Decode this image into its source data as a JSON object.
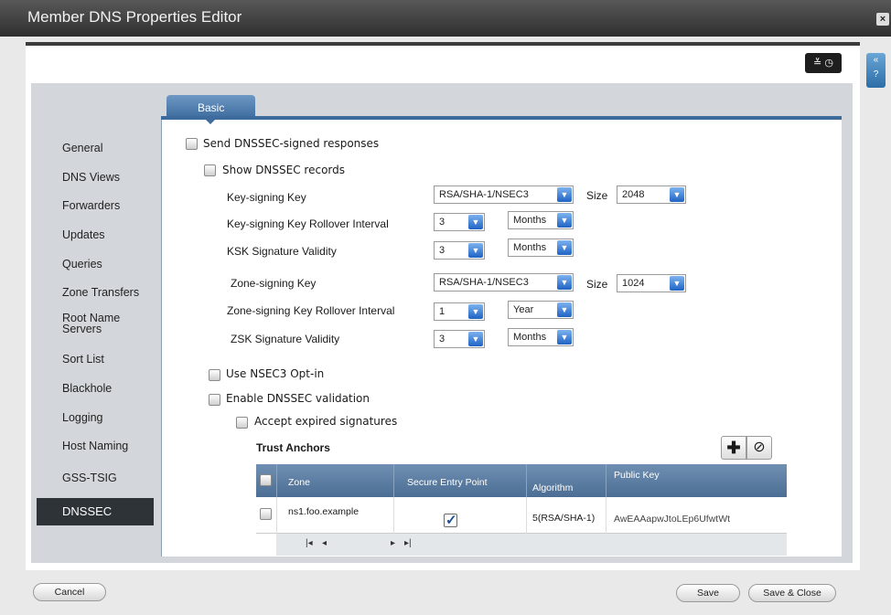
{
  "window": {
    "title": "Member DNS Properties Editor",
    "close_icon": "close-icon"
  },
  "toolbar": {
    "icons": [
      "collapse-icon",
      "history-icon"
    ]
  },
  "nav": {
    "items": [
      "General",
      "DNS Views",
      "Forwarders",
      "Updates",
      "Queries",
      "Zone Transfers",
      "Root Name Servers",
      "Sort List",
      "Blackhole",
      "Logging",
      "Host Naming",
      "GSS-TSIG",
      "DNSSEC"
    ],
    "active": "DNSSEC"
  },
  "tabs": {
    "basic": "Basic"
  },
  "form": {
    "send_dnssec": "Send DNSSEC-signed responses",
    "show_dnssec": "Show DNSSEC records",
    "ksk_label": "Key-signing Key",
    "ksk_algorithm": "RSA/SHA-1/NSEC3",
    "size_label": "Size",
    "ksk_size": "2048",
    "ksk_rollover_label": "Key-signing Key Rollover Interval",
    "ksk_rollover_value": "3",
    "ksk_rollover_unit": "Months",
    "ksk_validity_label": "KSK Signature Validity",
    "ksk_validity_value": "3",
    "ksk_validity_unit": "Months",
    "zsk_label": "Zone-signing Key",
    "zsk_algorithm": "RSA/SHA-1/NSEC3",
    "zsk_size": "1024",
    "zsk_rollover_label": "Zone-signing Key Rollover Interval",
    "zsk_rollover_value": "1",
    "zsk_rollover_unit": "Year",
    "zsk_validity_label": "ZSK Signature Validity",
    "zsk_validity_value": "3",
    "zsk_validity_unit": "Months",
    "nsec3_optin": "Use NSEC3 Opt-in",
    "enable_validation": "Enable  DNSSEC validation",
    "accept_expired": "Accept expired signatures"
  },
  "trust_anchors": {
    "title": "Trust Anchors",
    "columns": [
      "Zone",
      "Secure Entry Point",
      "Algorithm",
      "Public Key"
    ],
    "rows": [
      {
        "zone": "ns1.foo.example",
        "secure_entry_point": true,
        "algorithm": "5(RSA/SHA-1)",
        "public_key": "AwEAAapwJtoLEp6UfwtWt"
      }
    ],
    "pager": {
      "first": "|◂",
      "prev": "◂",
      "next": "▸",
      "last": "▸|"
    }
  },
  "buttons": {
    "cancel": "Cancel",
    "save": "Save",
    "save_close": "Save & Close"
  }
}
